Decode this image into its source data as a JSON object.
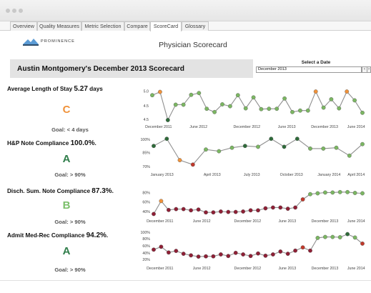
{
  "tabs": [
    "Overview",
    "Quality Measures",
    "Metric Selection",
    "Compare",
    "ScoreCard",
    "Glossary"
  ],
  "active_tab": "ScoreCard",
  "brand": "PROMINENCE",
  "page_title": "Physician Scorecard",
  "scorecard_title": "Austin Montgomery's December 2013 Scorecard",
  "date_picker": {
    "label": "Select a Date",
    "value": "December 2013",
    "prev": "‹",
    "next": "›"
  },
  "colors": {
    "green": "#7bb662",
    "dark_green": "#2f6b3a",
    "orange": "#f0923a",
    "red": "#c0392b",
    "dark_red": "#8e1f35",
    "grade_c": "#f0923a",
    "grade_a": "#2f7d4a",
    "grade_b": "#7bbf6a"
  },
  "metrics": [
    {
      "name": "Average Length of Stay ",
      "value": "5.27",
      "suffix": " days",
      "grade": "C",
      "goal": "Goal: < 4 days"
    },
    {
      "name": "H&P Note Compliance ",
      "value": "100.0%",
      "suffix": ".",
      "grade": "A",
      "goal": "Goal: > 90%"
    },
    {
      "name": "Disch. Sum. Note Compliance ",
      "value": "87.3%",
      "suffix": ".",
      "grade": "B",
      "goal": "Goal: > 90%"
    },
    {
      "name": "Admit Med-Rec Compliance ",
      "value": "94.2%",
      "suffix": ".",
      "grade": "A",
      "goal": "Goal: > 90%"
    }
  ],
  "chart_data": [
    {
      "type": "line",
      "y_ticks": [
        "5.0",
        "4.5",
        "4.5"
      ],
      "x_labels": [
        "December 2011",
        "June 2012",
        "December 2012",
        "June 2013",
        "December 2013",
        "June 2014"
      ],
      "ylim": [
        4.3,
        5.2
      ],
      "values": [
        4.98,
        5.07,
        4.3,
        4.72,
        4.72,
        4.99,
        5.04,
        4.61,
        4.52,
        4.73,
        4.68,
        4.98,
        4.62,
        4.92,
        4.6,
        4.61,
        4.61,
        4.89,
        4.52,
        4.56,
        4.56,
        5.08,
        4.64,
        4.87,
        4.62,
        5.08,
        4.84,
        4.5
      ],
      "point_colors": [
        "green",
        "orange",
        "dark_green",
        "green",
        "green",
        "green",
        "green",
        "green",
        "green",
        "green",
        "green",
        "green",
        "green",
        "green",
        "green",
        "green",
        "green",
        "green",
        "green",
        "green",
        "green",
        "orange",
        "green",
        "green",
        "green",
        "orange",
        "green",
        "green"
      ]
    },
    {
      "type": "line",
      "y_ticks": [
        "100%",
        "85%",
        "70%"
      ],
      "x_labels": [
        "January 2013",
        "April 2013",
        "July 2013",
        "October 2013",
        "January 2014",
        "April 2014"
      ],
      "ylim": [
        68,
        101
      ],
      "values": [
        92,
        100,
        76,
        71,
        88,
        86,
        90,
        92,
        91,
        100,
        91,
        100,
        89,
        89,
        90,
        81,
        94
      ],
      "point_colors": [
        "dark_green",
        "dark_green",
        "orange",
        "red",
        "green",
        "green",
        "green",
        "dark_green",
        "green",
        "dark_green",
        "dark_green",
        "dark_green",
        "green",
        "green",
        "green",
        "green",
        "green"
      ]
    },
    {
      "type": "line",
      "y_ticks": [
        "80%",
        "60%",
        "40%"
      ],
      "x_labels": [
        "December 2011",
        "June 2012",
        "December 2012",
        "June 2013",
        "December 2013",
        "June 2014"
      ],
      "ylim": [
        30,
        90
      ],
      "values": [
        31,
        63,
        41,
        43,
        43,
        40,
        42,
        35,
        35,
        37,
        36,
        36,
        37,
        40,
        40,
        45,
        47,
        47,
        44,
        47,
        67,
        80,
        82,
        84,
        84,
        85,
        85,
        83,
        82
      ],
      "point_colors": [
        "dark_red",
        "orange",
        "dark_red",
        "dark_red",
        "dark_red",
        "dark_red",
        "dark_red",
        "dark_red",
        "dark_red",
        "dark_red",
        "dark_red",
        "dark_red",
        "dark_red",
        "dark_red",
        "dark_red",
        "dark_red",
        "dark_red",
        "dark_red",
        "dark_red",
        "dark_red",
        "red",
        "green",
        "green",
        "green",
        "green",
        "green",
        "green",
        "green",
        "green"
      ]
    },
    {
      "type": "line",
      "y_ticks": [
        "100%",
        "80%",
        "60%",
        "40%",
        "20%"
      ],
      "x_labels": [
        "December 2011",
        "June 2012",
        "December 2012",
        "June 2013",
        "December 2013",
        "June 2014"
      ],
      "ylim": [
        15,
        105
      ],
      "values": [
        48,
        57,
        39,
        44,
        35,
        30,
        26,
        27,
        27,
        33,
        28,
        38,
        33,
        28,
        36,
        29,
        33,
        42,
        35,
        45,
        55,
        45,
        85,
        88,
        88,
        87,
        97,
        86,
        67
      ],
      "point_colors": [
        "dark_red",
        "dark_red",
        "dark_red",
        "dark_red",
        "dark_red",
        "dark_red",
        "dark_red",
        "dark_red",
        "dark_red",
        "dark_red",
        "dark_red",
        "dark_red",
        "dark_red",
        "dark_red",
        "dark_red",
        "dark_red",
        "dark_red",
        "dark_red",
        "dark_red",
        "dark_red",
        "red",
        "dark_red",
        "green",
        "green",
        "green",
        "green",
        "dark_green",
        "green",
        "red"
      ]
    }
  ]
}
